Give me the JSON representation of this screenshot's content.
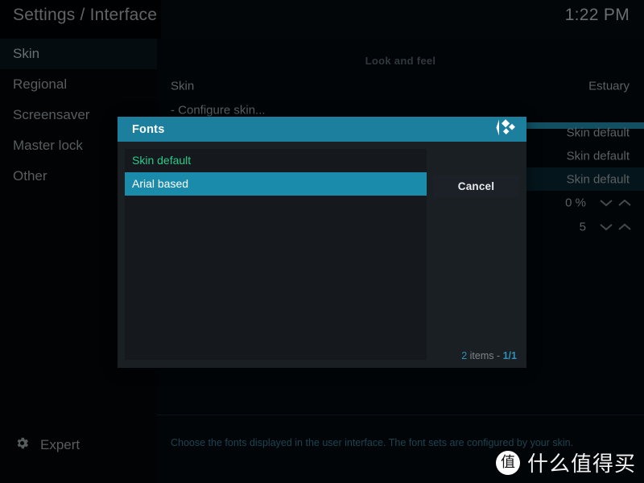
{
  "header": {
    "breadcrumb": "Settings / Interface",
    "clock": "1:22 PM"
  },
  "sidebar": {
    "items": [
      {
        "label": "Skin",
        "selected": true
      },
      {
        "label": "Regional",
        "selected": false
      },
      {
        "label": "Screensaver",
        "selected": false
      },
      {
        "label": "Master lock",
        "selected": false
      },
      {
        "label": "Other",
        "selected": false
      }
    ],
    "expert": {
      "label": "Expert",
      "icon": "gear-icon"
    }
  },
  "main": {
    "section_title": "Look and feel",
    "rows": [
      {
        "label": "Skin",
        "value": "Estuary",
        "state": "normal",
        "spinner": false
      },
      {
        "label": "- Configure skin...",
        "value": "",
        "state": "normal",
        "spinner": false
      },
      {
        "label": "",
        "value": "",
        "state": "bar",
        "spinner": false
      },
      {
        "label": "",
        "value": "Skin default",
        "state": "normal",
        "spinner": false
      },
      {
        "label": "",
        "value": "Skin default",
        "state": "normal",
        "spinner": false
      },
      {
        "label": "",
        "value": "Skin default",
        "state": "highlight",
        "spinner": false
      },
      {
        "label": "",
        "value": "0 %",
        "state": "normal",
        "spinner": true
      },
      {
        "label": "",
        "value": "5",
        "state": "normal",
        "spinner": true
      }
    ],
    "description": "Choose the fonts displayed in the user interface. The font sets are configured by your skin."
  },
  "dialog": {
    "title": "Fonts",
    "logo_icon": "kodi-logo-icon",
    "items": [
      {
        "label": "Skin default",
        "selected": false
      },
      {
        "label": "Arial based",
        "selected": true
      }
    ],
    "cancel_label": "Cancel",
    "count_prefix": "2",
    "count_middle": " items - ",
    "count_page": "1/1"
  },
  "watermark": {
    "badge": "值",
    "text": "什么值得买"
  },
  "colors": {
    "accent_teal": "#1b7f9d",
    "selected_teal": "#1b8bab",
    "green": "#2ec98a",
    "highlight_row": "#07222b"
  }
}
